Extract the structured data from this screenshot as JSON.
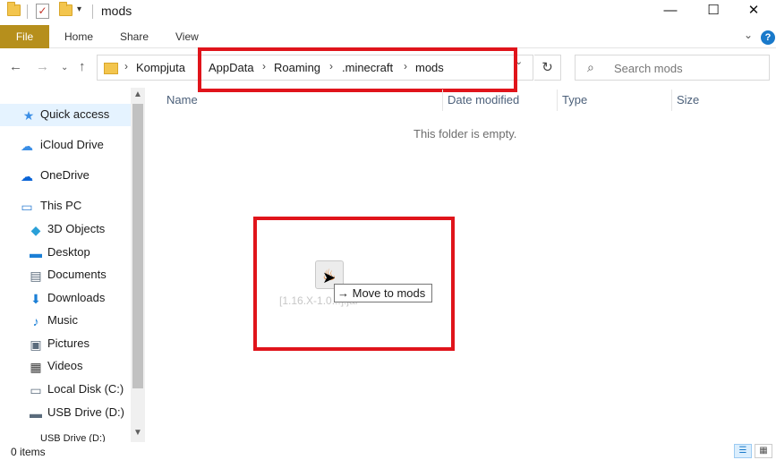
{
  "window": {
    "title": "mods"
  },
  "ribbon": {
    "tabs": [
      "File",
      "Home",
      "Share",
      "View"
    ]
  },
  "address": {
    "breadcrumbs": [
      "Kompjuta",
      "AppData",
      "Roaming",
      ".minecraft",
      "mods"
    ]
  },
  "search": {
    "placeholder": "Search mods"
  },
  "sidebar": {
    "items": [
      {
        "label": "Quick access",
        "icon": "star-icon"
      },
      {
        "label": "iCloud Drive",
        "icon": "icloud-icon"
      },
      {
        "label": "OneDrive",
        "icon": "cloud-icon"
      },
      {
        "label": "This PC",
        "icon": "computer-icon"
      },
      {
        "label": "3D Objects",
        "icon": "cube-icon"
      },
      {
        "label": "Desktop",
        "icon": "desktop-icon"
      },
      {
        "label": "Documents",
        "icon": "document-icon"
      },
      {
        "label": "Downloads",
        "icon": "download-arrow-icon"
      },
      {
        "label": "Music",
        "icon": "music-note-icon"
      },
      {
        "label": "Pictures",
        "icon": "picture-icon"
      },
      {
        "label": "Videos",
        "icon": "film-icon"
      },
      {
        "label": "Local Disk (C:)",
        "icon": "drive-icon"
      },
      {
        "label": "USB Drive (D:)",
        "icon": "usb-drive-icon"
      },
      {
        "label": "USB Drive (D:)",
        "icon": "usb-drive-icon"
      }
    ]
  },
  "columns": [
    "Name",
    "Date modified",
    "Type",
    "Size"
  ],
  "content": {
    "empty_message": "This folder is empty.",
    "drag_file_name": "[1.16.X-1.0...].jar",
    "drag_tooltip": "Move to mods"
  },
  "status": {
    "items_count": "0 items"
  },
  "colors": {
    "file_tab": "#b68f1c",
    "highlight_box": "#e0141b",
    "accent": "#1979ca"
  }
}
